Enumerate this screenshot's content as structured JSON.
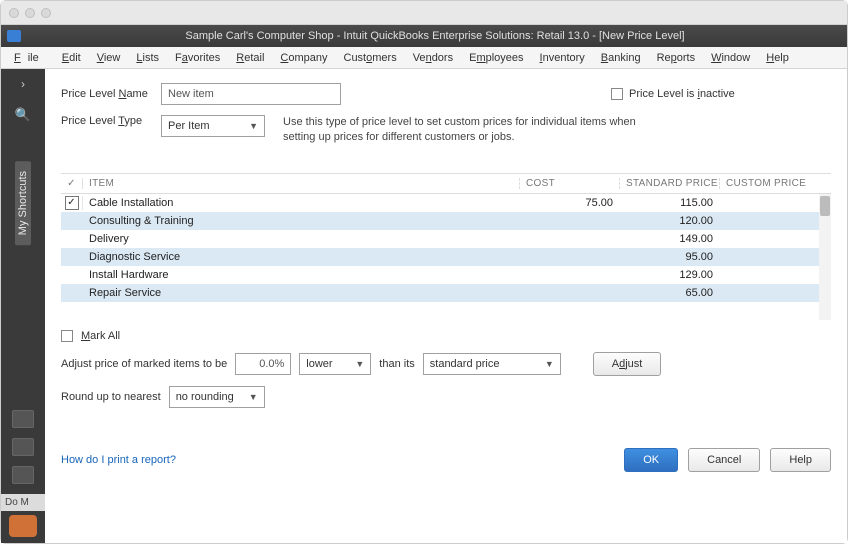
{
  "window": {
    "title": "Sample Carl's Computer Shop  - Intuit QuickBooks Enterprise Solutions: Retail 13.0 - [New Price Level]"
  },
  "menu": [
    "File",
    "Edit",
    "View",
    "Lists",
    "Favorites",
    "Retail",
    "Company",
    "Customers",
    "Vendors",
    "Employees",
    "Inventory",
    "Banking",
    "Reports",
    "Window",
    "Help"
  ],
  "leftbar": {
    "shortcuts_label": "My Shortcuts",
    "do_label": "Do M"
  },
  "fields": {
    "name_label": "Price Level Name",
    "name_value": "New item",
    "inactive_label": "Price Level is inactive",
    "type_label": "Price Level Type",
    "type_value": "Per Item",
    "type_help": "Use this type of price level to set custom prices for individual items when setting up prices for different customers or jobs."
  },
  "table": {
    "headers": {
      "check": "✓",
      "item": "ITEM",
      "cost": "COST",
      "std": "STANDARD PRICE",
      "cust": "CUSTOM PRICE"
    },
    "rows": [
      {
        "checked": true,
        "item": "Cable Installation",
        "cost": "75.00",
        "std": "115.00",
        "cust": ""
      },
      {
        "checked": false,
        "item": "Consulting & Training",
        "cost": "",
        "std": "120.00",
        "cust": ""
      },
      {
        "checked": false,
        "item": "Delivery",
        "cost": "",
        "std": "149.00",
        "cust": ""
      },
      {
        "checked": false,
        "item": "Diagnostic Service",
        "cost": "",
        "std": "95.00",
        "cust": ""
      },
      {
        "checked": false,
        "item": "Install Hardware",
        "cost": "",
        "std": "129.00",
        "cust": ""
      },
      {
        "checked": false,
        "item": "Repair Service",
        "cost": "",
        "std": "65.00",
        "cust": ""
      },
      {
        "checked": false,
        "item": "",
        "cost": "",
        "std": "",
        "cust": ""
      }
    ]
  },
  "mark_all_label": "Mark All",
  "adjust": {
    "label": "Adjust price of marked items to be",
    "percent": "0.0%",
    "direction": "lower",
    "than_label": "than its",
    "basis": "standard price",
    "button": "Adjust"
  },
  "round": {
    "label": "Round up to nearest",
    "value": "no rounding"
  },
  "help_link": "How do I print a report?",
  "buttons": {
    "ok": "OK",
    "cancel": "Cancel",
    "help": "Help"
  }
}
